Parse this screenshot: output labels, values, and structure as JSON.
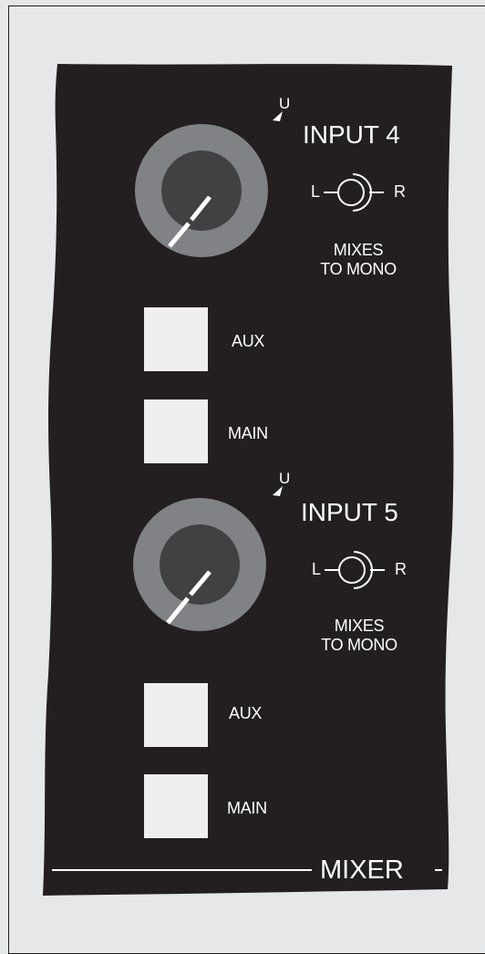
{
  "channels": [
    {
      "title": "INPUT 4",
      "unity_mark": "U",
      "pan": {
        "left": "L",
        "right": "R"
      },
      "mixes_line1": "MIXES",
      "mixes_line2": "TO MONO",
      "aux_label": "AUX",
      "main_label": "MAIN"
    },
    {
      "title": "INPUT 5",
      "unity_mark": "U",
      "pan": {
        "left": "L",
        "right": "R"
      },
      "mixes_line1": "MIXES",
      "mixes_line2": "TO MONO",
      "aux_label": "AUX",
      "main_label": "MAIN"
    }
  ],
  "section_label": "MIXER",
  "colors": {
    "panel": "#231f20",
    "background": "#e6e7e8",
    "knob_ring": "#808285",
    "knob_cap": "#414042",
    "button": "#efefef",
    "text": "#ffffff"
  },
  "icons": {
    "unity": "triangle-marker",
    "pan": "pan-symbol"
  }
}
